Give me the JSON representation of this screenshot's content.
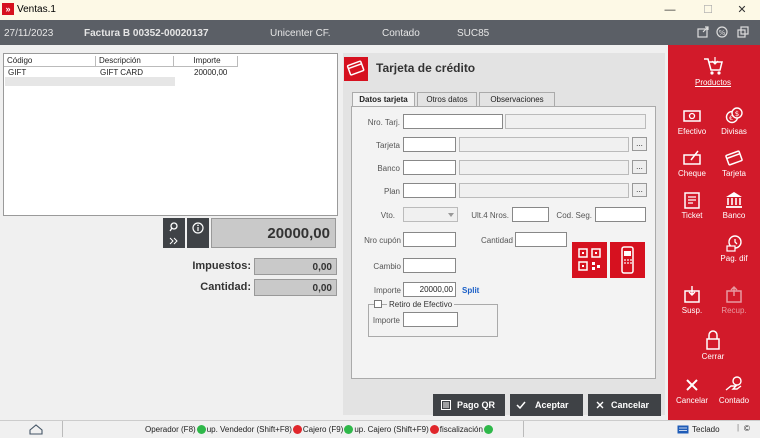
{
  "window": {
    "title": "Ventas.1",
    "controls": [
      "—",
      "☐",
      "✕"
    ]
  },
  "infobar": {
    "date": "27/11/2023",
    "document": "Factura B 00352-00020137",
    "customer": "Unicenter CF.",
    "payment": "Contado",
    "branch": "SUC85"
  },
  "grid": {
    "headers": [
      "Código",
      "Descripción",
      "Importe"
    ],
    "rows": [
      {
        "codigo": "GIFT",
        "descripcion": "GIFT CARD",
        "importe": "20000,00"
      }
    ]
  },
  "totals": {
    "total": "20000,00",
    "impuestos_label": "Impuestos:",
    "impuestos": "0,00",
    "cantidad_label": "Cantidad:",
    "cantidad": "0,00"
  },
  "card": {
    "title": "Tarjeta de crédito",
    "tabs": [
      "Datos tarjeta",
      "Otros datos",
      "Observaciones"
    ],
    "fields": {
      "nro_tarj": "Nro. Tarj.",
      "tarjeta": "Tarjeta",
      "banco": "Banco",
      "plan": "Plan",
      "vto": "Vto.",
      "ult4": "Ult.4 Nros.",
      "cod_seg": "Cod. Seg.",
      "nro_cupon": "Nro cupón",
      "cantidad": "Cantidad",
      "cambio": "Cambio",
      "importe": "Importe",
      "importe_value": "20000,00",
      "split": "Split",
      "retiro": "Retiro de Efectivo",
      "retiro_importe": "Importe",
      "dots": "..."
    },
    "buttons": {
      "pago_qr": "Pago QR",
      "aceptar": "Aceptar",
      "cancelar": "Cancelar"
    }
  },
  "sidebar": {
    "productos": "Productos",
    "efectivo": "Efectivo",
    "divisas": "Divisas",
    "cheque": "Cheque",
    "tarjeta": "Tarjeta",
    "ticket": "Ticket",
    "banco": "Banco",
    "pag_dif": "Pag. dif",
    "susp": "Susp.",
    "recup": "Recup.",
    "cerrar": "Cerrar",
    "cancelar": "Cancelar",
    "contado": "Contado"
  },
  "statusbar": {
    "items": [
      "Operador (F8)",
      "up. Vendedor (Shift+F8)",
      "Cajero (F9)",
      "up. Cajero (Shift+F9)",
      "fiscalización"
    ],
    "teclado": "Teclado",
    "colors": {
      "ok": "#2fb84a",
      "err": "#e0262b"
    }
  },
  "colors": {
    "accent": "#d21a2a",
    "infobar": "#5b5f66",
    "dark_button": "#3f4246"
  }
}
